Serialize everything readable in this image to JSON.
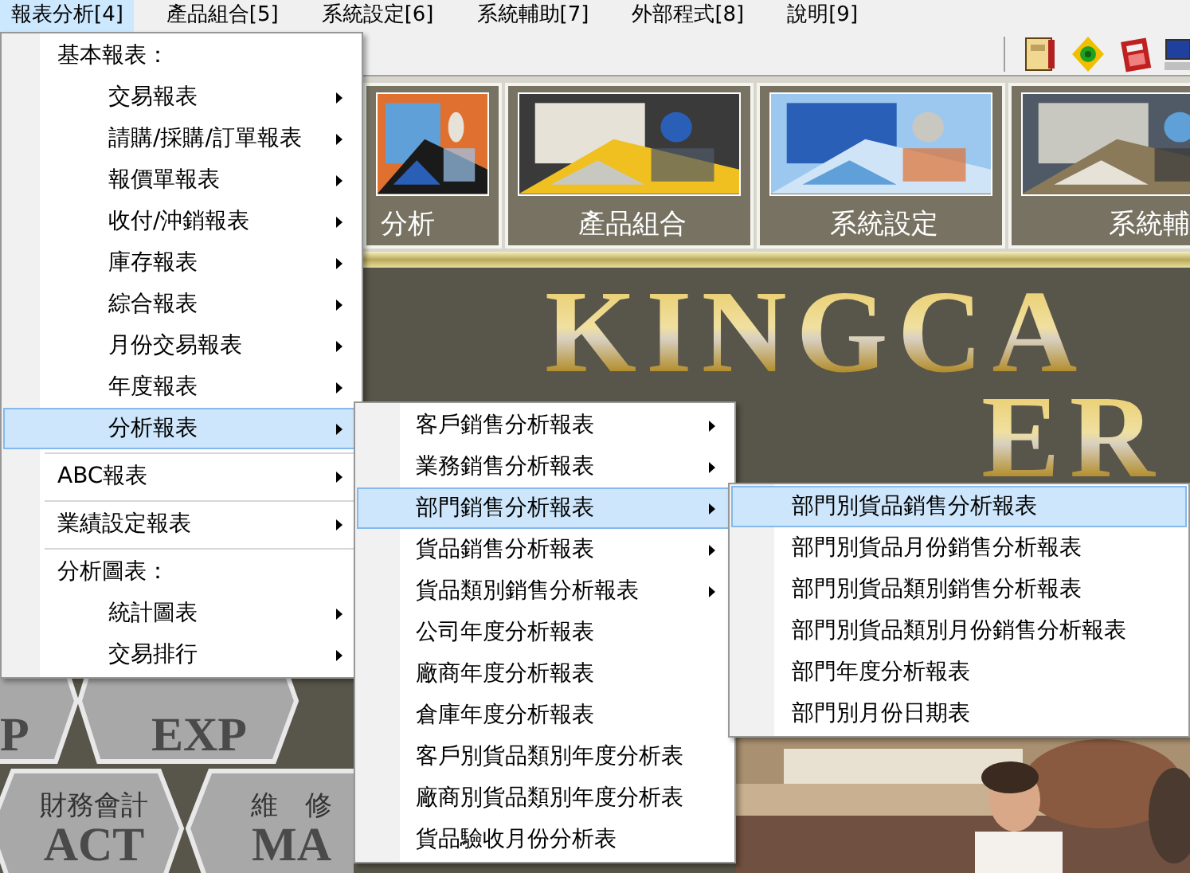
{
  "menubar": [
    {
      "label": "報表分析[4]",
      "selected": true
    },
    {
      "label": "產品組合[5]",
      "selected": false
    },
    {
      "label": "系統設定[6]",
      "selected": false
    },
    {
      "label": "系統輔助[7]",
      "selected": false
    },
    {
      "label": "外部程式[8]",
      "selected": false
    },
    {
      "label": "說明[9]",
      "selected": false
    }
  ],
  "tiles": [
    {
      "label": "分析"
    },
    {
      "label": "產品組合"
    },
    {
      "label": "系統設定"
    },
    {
      "label": "系統輔"
    }
  ],
  "logo_lines": [
    "KINGCA",
    "ER"
  ],
  "hex_tiles": [
    {
      "code": "P"
    },
    {
      "code": "EXP"
    },
    {
      "title": "財務會計",
      "code": "ACT"
    },
    {
      "title": "維　修",
      "code": "MA"
    }
  ],
  "menus": [
    {
      "items": [
        {
          "kind": "group",
          "label": "基本報表：",
          "children": [
            {
              "kind": "item",
              "label": "交易報表",
              "submenu": true,
              "selected": false
            },
            {
              "kind": "item",
              "label": "請購/採購/訂單報表",
              "submenu": true,
              "selected": false
            },
            {
              "kind": "item",
              "label": "報價單報表",
              "submenu": true,
              "selected": false
            },
            {
              "kind": "item",
              "label": "收付/沖銷報表",
              "submenu": true,
              "selected": false
            },
            {
              "kind": "item",
              "label": "庫存報表",
              "submenu": true,
              "selected": false
            },
            {
              "kind": "item",
              "label": "綜合報表",
              "submenu": true,
              "selected": false
            },
            {
              "kind": "item",
              "label": "月份交易報表",
              "submenu": true,
              "selected": false
            },
            {
              "kind": "item",
              "label": "年度報表",
              "submenu": true,
              "selected": false
            },
            {
              "kind": "item",
              "label": "分析報表",
              "submenu": true,
              "selected": true
            }
          ]
        },
        {
          "kind": "separator"
        },
        {
          "kind": "item",
          "label": "ABC報表",
          "submenu": true,
          "selected": false
        },
        {
          "kind": "separator"
        },
        {
          "kind": "item",
          "label": "業績設定報表",
          "submenu": true,
          "selected": false
        },
        {
          "kind": "separator"
        },
        {
          "kind": "group",
          "label": "分析圖表：",
          "children": [
            {
              "kind": "item",
              "label": "統計圖表",
              "submenu": true,
              "selected": false
            },
            {
              "kind": "item",
              "label": "交易排行",
              "submenu": true,
              "selected": false
            }
          ]
        }
      ]
    },
    {
      "items": [
        {
          "kind": "item",
          "label": "客戶銷售分析報表",
          "submenu": true,
          "selected": false
        },
        {
          "kind": "item",
          "label": "業務銷售分析報表",
          "submenu": true,
          "selected": false
        },
        {
          "kind": "item",
          "label": "部門銷售分析報表",
          "submenu": true,
          "selected": true
        },
        {
          "kind": "item",
          "label": "貨品銷售分析報表",
          "submenu": true,
          "selected": false
        },
        {
          "kind": "item",
          "label": "貨品類別銷售分析報表",
          "submenu": true,
          "selected": false
        },
        {
          "kind": "item",
          "label": "公司年度分析報表",
          "submenu": false,
          "selected": false
        },
        {
          "kind": "item",
          "label": "廠商年度分析報表",
          "submenu": false,
          "selected": false
        },
        {
          "kind": "item",
          "label": "倉庫年度分析報表",
          "submenu": false,
          "selected": false
        },
        {
          "kind": "item",
          "label": "客戶別貨品類別年度分析表",
          "submenu": false,
          "selected": false
        },
        {
          "kind": "item",
          "label": "廠商別貨品類別年度分析表",
          "submenu": false,
          "selected": false
        },
        {
          "kind": "item",
          "label": "貨品驗收月份分析表",
          "submenu": false,
          "selected": false
        }
      ]
    },
    {
      "items": [
        {
          "kind": "item",
          "label": "部門別貨品銷售分析報表",
          "submenu": false,
          "selected": true
        },
        {
          "kind": "item",
          "label": "部門別貨品月份銷售分析報表",
          "submenu": false,
          "selected": false
        },
        {
          "kind": "item",
          "label": "部門別貨品類別銷售分析報表",
          "submenu": false,
          "selected": false
        },
        {
          "kind": "item",
          "label": "部門別貨品類別月份銷售分析報表",
          "submenu": false,
          "selected": false
        },
        {
          "kind": "item",
          "label": "部門年度分析報表",
          "submenu": false,
          "selected": false
        },
        {
          "kind": "item",
          "label": "部門別月份日期表",
          "submenu": false,
          "selected": false
        }
      ]
    }
  ]
}
